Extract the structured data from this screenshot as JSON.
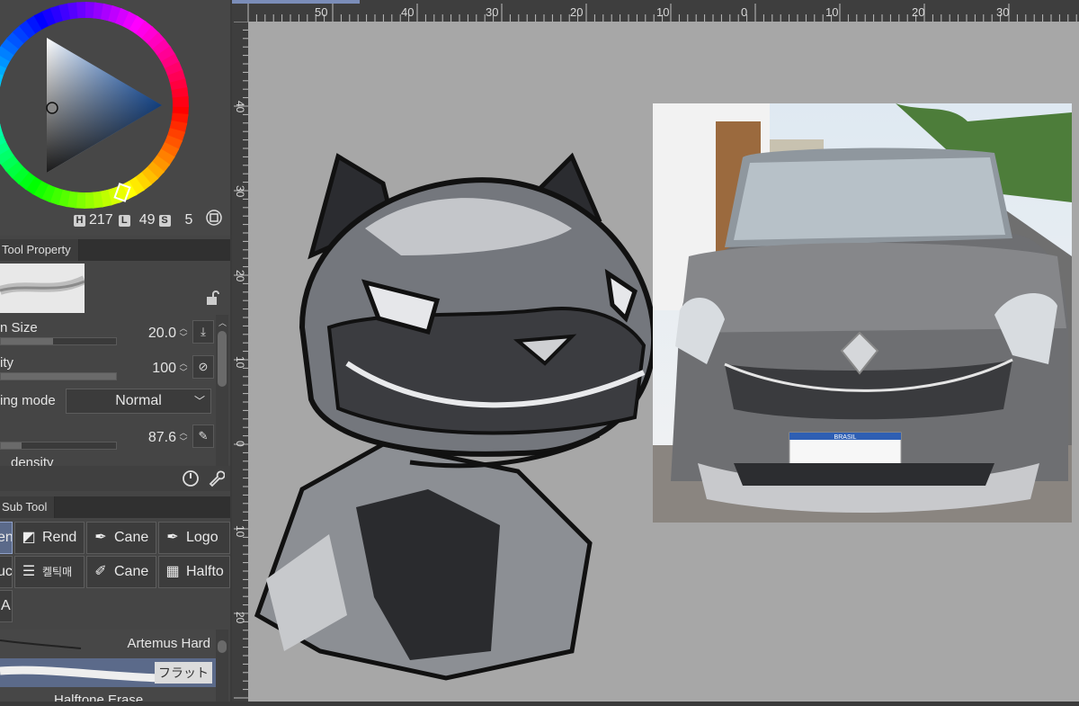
{
  "color": {
    "h_badge": "H",
    "h_value": "217",
    "l_badge": "L",
    "l_value": "49",
    "s_badge": "S",
    "s_value": "5",
    "colors": {
      "panel": "#474747",
      "accent": "#5b6a8a",
      "canvas": "#a7a7a7"
    }
  },
  "tool_property": {
    "tab_label": "Tool Property",
    "rows": [
      {
        "label": "n Size",
        "value": "20.0",
        "fill": 0.45
      },
      {
        "label": "ity",
        "value": "100",
        "fill": 1.0
      },
      {
        "label": "ing mode",
        "select": "Normal"
      },
      {
        "label": "",
        "value": "87.6",
        "fill": 0.18
      },
      {
        "label": "density"
      }
    ]
  },
  "sub_tool": {
    "tab_label": "Sub Tool",
    "buttons": [
      {
        "label": "en"
      },
      {
        "label": "Rend"
      },
      {
        "label": "Cane"
      },
      {
        "label": "Logo"
      },
      {
        "label": "uc"
      },
      {
        "label": "켈틱매"
      },
      {
        "label": "Cane"
      },
      {
        "label": "Halfto"
      },
      {
        "label": "A"
      }
    ],
    "brushes": [
      {
        "label": "Artemus Hard"
      },
      {
        "label": "フラット"
      },
      {
        "label": "Halftone Erase"
      }
    ]
  },
  "ruler": {
    "top": [
      "50",
      "40",
      "30",
      "20",
      "10",
      "0",
      "10",
      "20",
      "30"
    ],
    "left": [
      "40",
      "30",
      "20",
      "10",
      "0",
      "10",
      "20"
    ]
  },
  "reference": {
    "plate": "BRASIL"
  }
}
